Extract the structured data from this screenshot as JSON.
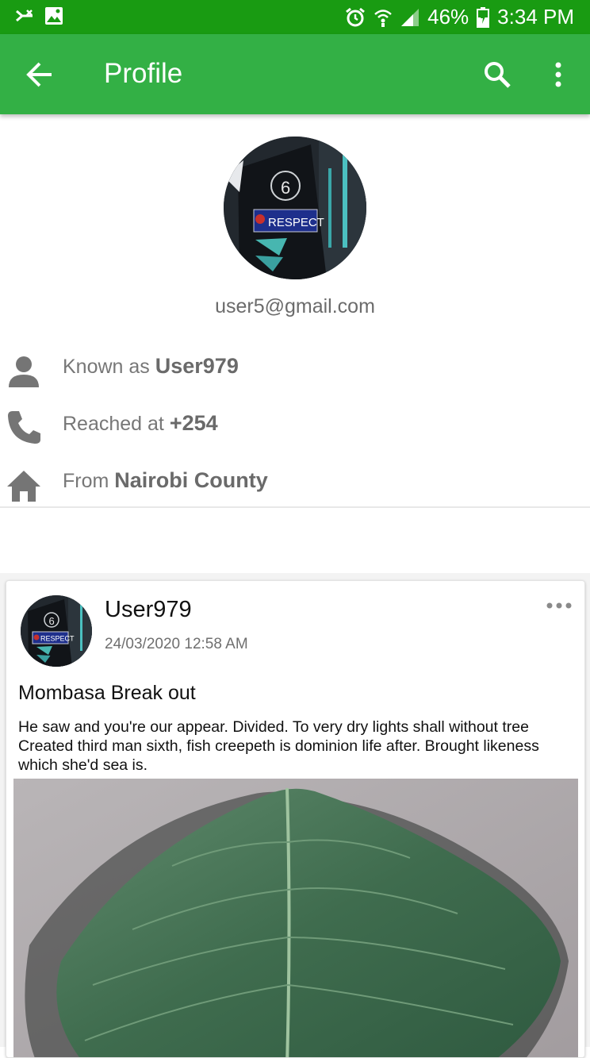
{
  "status_bar": {
    "battery": "46%",
    "time": "3:34 PM"
  },
  "app_bar": {
    "title": "Profile"
  },
  "profile": {
    "email": "user5@gmail.com",
    "avatar_badge_text": "RESPECT",
    "known_as_prefix": "Known as ",
    "known_as_value": "User979",
    "reached_prefix": "Reached at ",
    "reached_value": "+254",
    "from_prefix": "From ",
    "from_value": "Nairobi County"
  },
  "post": {
    "author": "User979",
    "date": "24/03/2020 12:58 AM",
    "title": "Mombasa Break out",
    "body": "He saw and you're our appear. Divided. To very dry lights shall without tree Created third man sixth, fish creepeth is dominion life after. Brought likeness which she'd sea is.",
    "avatar_badge_text": "RESPECT"
  },
  "colors": {
    "status_bar": "#199b12",
    "app_bar": "#33b045",
    "icon_gray": "#757575"
  }
}
